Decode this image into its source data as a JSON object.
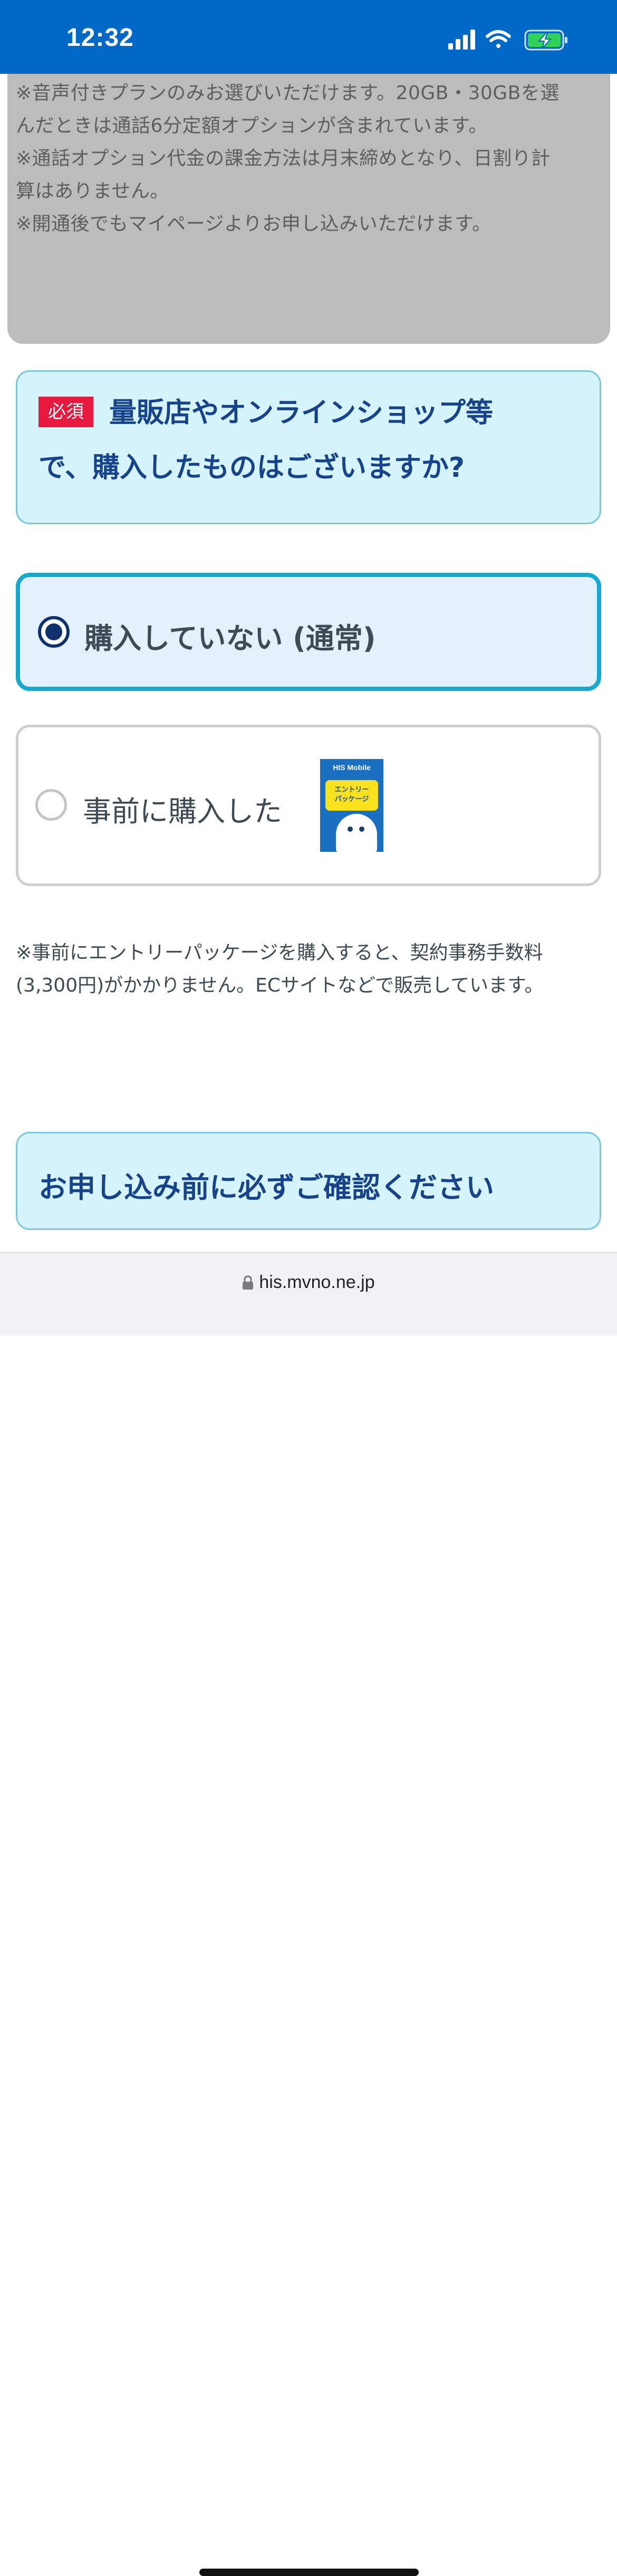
{
  "status_bar": {
    "time": "12:32",
    "icons": [
      "signal-icon",
      "wifi-icon",
      "battery-charging-icon"
    ],
    "background": "#0068c6"
  },
  "notes_panel": {
    "lines": [
      "※音声付きプランのみお選びいただけます。20GB・30GBを選",
      "んだときは通話6分定額オプションが含まれています。",
      "※通話オプション代金の課金方法は月末締めとなり、日割り計",
      "算はありません。",
      "※開通後でもマイページよりお申し込みいただけます。"
    ]
  },
  "question": {
    "badge": "必須",
    "line1": "量販店やオンラインショップ等",
    "line2": "で、購入したものはございますか?"
  },
  "options": [
    {
      "label": "購入していない (通常)",
      "selected": true
    },
    {
      "label": "事前に購入した",
      "selected": false,
      "image": "entry-package-image"
    }
  ],
  "package": {
    "brand": "HIS Mobile",
    "label_line1": "エントリー",
    "label_line2": "パッケージ"
  },
  "entry_note": {
    "line1": "※事前にエントリーパッケージを購入すると、契約事務手数料",
    "line2": "(3,300円)がかかりません。ECサイトなどで販売しています。"
  },
  "confirm": {
    "label": "お申し込み前に必ずご確認ください"
  },
  "url_bar": {
    "url": "his.mvno.ne.jp",
    "icon": "lock-icon"
  },
  "colors": {
    "accent_dark_blue": "#16438c",
    "box_fill": "#d5f4fc",
    "selected_border": "#17a8cf",
    "required_red": "#e8193e"
  }
}
